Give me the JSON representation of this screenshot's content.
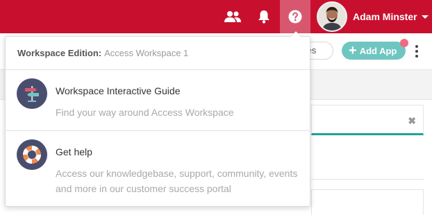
{
  "topbar": {
    "color": "#c8102e",
    "icons": [
      "people-icon",
      "bell-icon",
      "help-icon"
    ],
    "user_name": "Adam Minster"
  },
  "background": {
    "places_label": "ces",
    "add_app_label": "Add App"
  },
  "dropdown": {
    "edition_label": "Workspace Edition:",
    "edition_value": "Access Workspace 1",
    "items": [
      {
        "icon": "signpost-icon",
        "title": "Workspace Interactive Guide",
        "description": "Find your way around Access Workspace"
      },
      {
        "icon": "lifebuoy-icon",
        "title": "Get help",
        "description": "Access our knowledgebase, support, community, events and more in our customer success portal"
      }
    ]
  }
}
